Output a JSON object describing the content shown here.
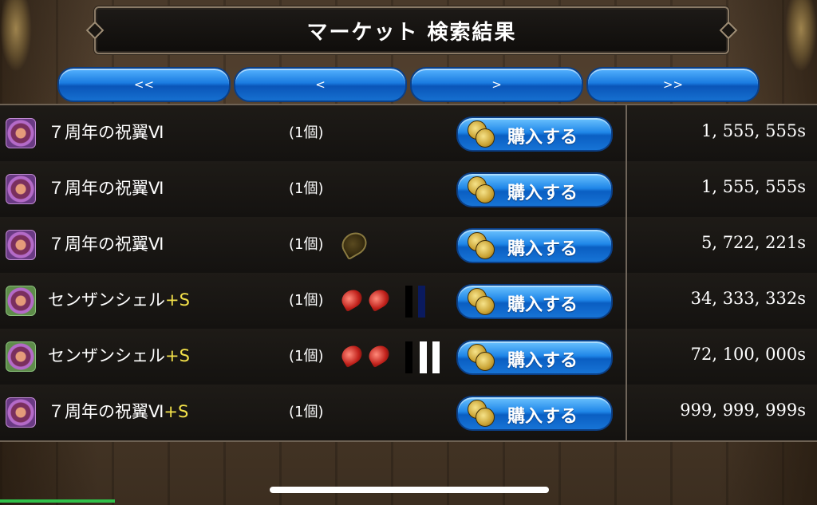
{
  "title": "マーケット 検索結果",
  "nav": {
    "first": "<<",
    "prev": "<",
    "next": ">",
    "last": ">>"
  },
  "rows": [
    {
      "name": "７周年の祝翼Ⅵ",
      "suffix": "",
      "qty": "(1個)",
      "buy": "購入する",
      "price": "1, 555, 555s"
    },
    {
      "name": "７周年の祝翼Ⅵ",
      "suffix": "",
      "qty": "(1個)",
      "buy": "購入する",
      "price": "1, 555, 555s"
    },
    {
      "name": "７周年の祝翼Ⅵ",
      "suffix": "",
      "qty": "(1個)",
      "buy": "購入する",
      "price": "5, 722, 221s"
    },
    {
      "name": "センザンシェル",
      "suffix": "+S",
      "qty": "(1個)",
      "buy": "購入する",
      "price": "34, 333, 332s"
    },
    {
      "name": "センザンシェル",
      "suffix": "+S",
      "qty": "(1個)",
      "buy": "購入する",
      "price": "72, 100, 000s"
    },
    {
      "name": "７周年の祝翼Ⅵ",
      "suffix": "+S",
      "qty": "(1個)",
      "buy": "購入する",
      "price": "999, 999, 999s"
    }
  ],
  "colors": {
    "accent_blue": "#1a7be0",
    "plus_yellow": "#f4e24a",
    "gem_red": "#c0201a"
  },
  "icons": {
    "item": "wing-item-icon",
    "coin": "gold-coin-icon",
    "gem": "red-gem-icon"
  }
}
